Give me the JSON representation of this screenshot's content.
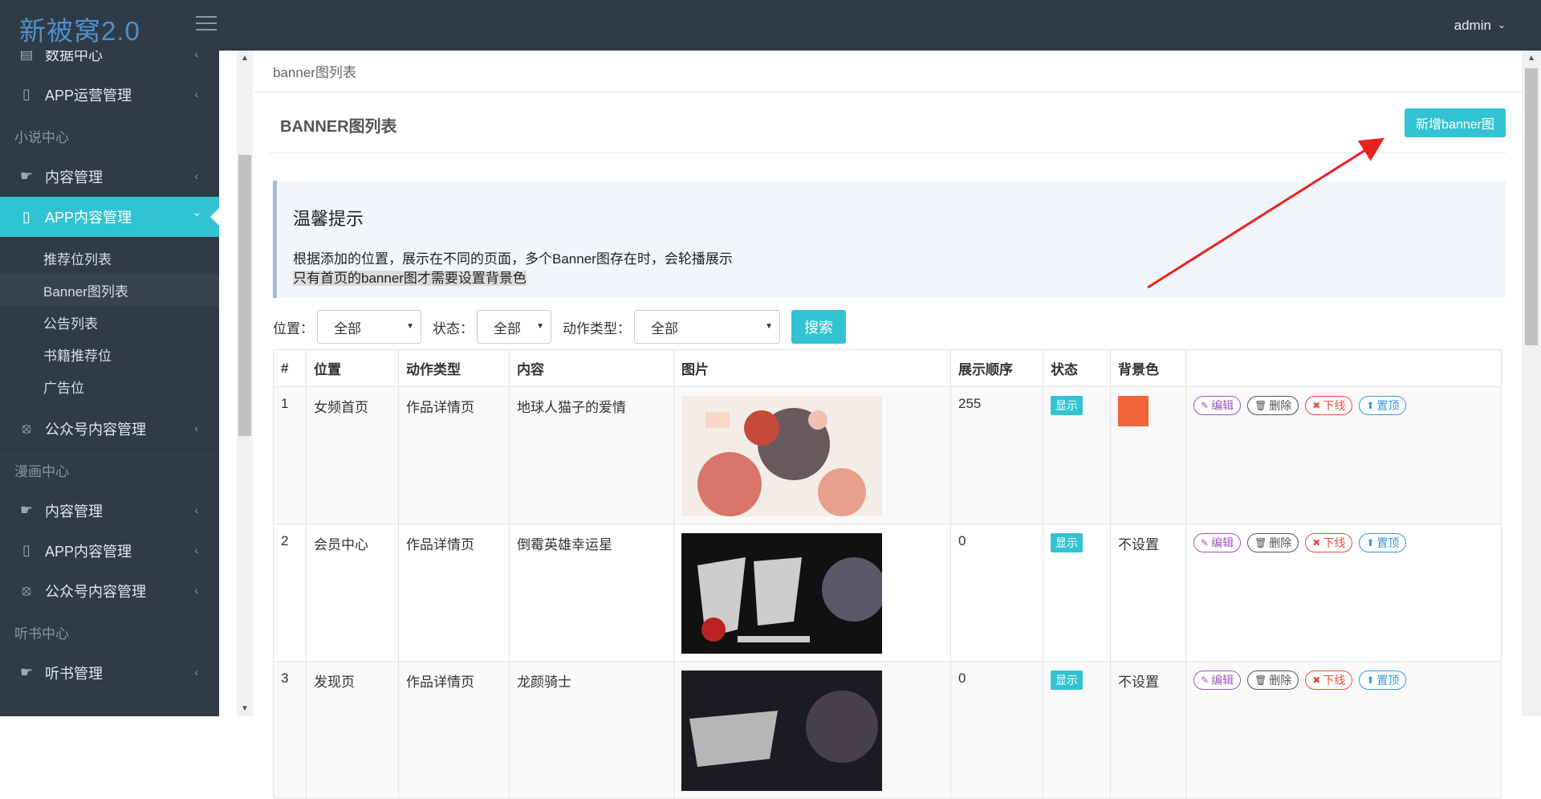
{
  "app": {
    "logo": "新被窝2.0",
    "user": "admin"
  },
  "colors": {
    "accent": "#32c3d2",
    "sidebar_bg": "#2f3b47",
    "bg_swatch": "#f2643a"
  },
  "sidebar": {
    "items": [
      {
        "label": "数据中心",
        "icon": "database-icon"
      },
      {
        "label": "APP运营管理",
        "icon": "mobile-icon"
      },
      {
        "section": "小说中心"
      },
      {
        "label": "内容管理",
        "icon": "hand-icon"
      },
      {
        "label": "APP内容管理",
        "icon": "mobile-icon",
        "active": true
      },
      {
        "sub": "推荐位列表"
      },
      {
        "sub": "Banner图列表",
        "selected": true
      },
      {
        "sub": "公告列表"
      },
      {
        "sub": "书籍推荐位"
      },
      {
        "sub": "广告位"
      },
      {
        "label": "公众号内容管理",
        "icon": "compass-icon"
      },
      {
        "section": "漫画中心"
      },
      {
        "label": "内容管理",
        "icon": "hand-icon"
      },
      {
        "label": "APP内容管理",
        "icon": "mobile-icon"
      },
      {
        "label": "公众号内容管理",
        "icon": "compass-icon"
      },
      {
        "section": "听书中心"
      },
      {
        "label": "听书管理",
        "icon": "hand-icon"
      }
    ]
  },
  "breadcrumb": "banner图列表",
  "page_title": "BANNER图列表",
  "add_button": "新增banner图",
  "tip": {
    "title": "温馨提示",
    "line1": "根据添加的位置，展示在不同的页面，多个Banner图存在时，会轮播展示",
    "line2": "只有首页的banner图才需要设置背景色"
  },
  "filters": {
    "position_label": "位置：",
    "position_value": "全部",
    "status_label": "状态：",
    "status_value": "全部",
    "action_label": "动作类型：",
    "action_value": "全部",
    "search": "搜索"
  },
  "table": {
    "headers": [
      "#",
      "位置",
      "动作类型",
      "内容",
      "图片",
      "展示顺序",
      "状态",
      "背景色",
      ""
    ],
    "ops": {
      "edit": "编辑",
      "delete": "删除",
      "offline": "下线",
      "top": "置顶"
    },
    "rows": [
      {
        "id": "1",
        "position": "女频首页",
        "action": "作品详情页",
        "content": "地球人猫子的爱情",
        "order": "255",
        "status": "显示",
        "bg": "",
        "image": "anime-illustration"
      },
      {
        "id": "2",
        "position": "会员中心",
        "action": "作品详情页",
        "content": "倒霉英雄幸运星",
        "order": "0",
        "status": "显示",
        "bg": "不设置",
        "image": "dark-cover"
      },
      {
        "id": "3",
        "position": "发现页",
        "action": "作品详情页",
        "content": "龙颜骑士",
        "order": "0",
        "status": "显示",
        "bg": "不设置",
        "image": "dark-cover-2"
      }
    ]
  }
}
